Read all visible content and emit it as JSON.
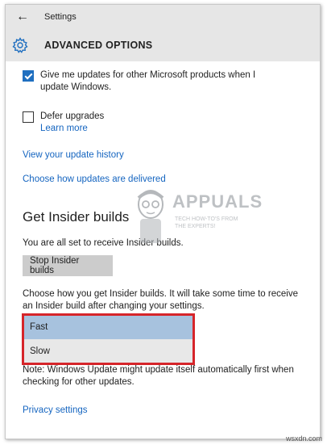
{
  "window": {
    "title": "Settings"
  },
  "header": {
    "page_title": "ADVANCED OPTIONS"
  },
  "options": {
    "microsoft_updates": {
      "label": "Give me updates for other Microsoft products when I update Windows.",
      "checked": true
    },
    "defer_upgrades": {
      "label": "Defer upgrades",
      "checked": false
    },
    "learn_more": "Learn more",
    "view_history": "View your update history",
    "choose_delivery": "Choose how updates are delivered"
  },
  "insider": {
    "heading": "Get Insider builds",
    "status": "You are all set to receive Insider builds.",
    "stop_button": "Stop Insider builds",
    "choose_text": "Choose how you get Insider builds. It will take some time to receive an Insider build after changing your settings.",
    "ring_options": [
      "Fast",
      "Slow"
    ],
    "selected_ring": "Fast",
    "note": "Note: Windows Update might update itself automatically first when checking for other updates."
  },
  "privacy_link": "Privacy settings",
  "watermark": {
    "brand": "APPUALS",
    "tagline": "TECH HOW-TO'S FROM THE EXPERTS!"
  },
  "site_credit": "wsxdn.com",
  "colors": {
    "accent": "#1f6fc0",
    "link": "#1565c0",
    "highlight": "#a7c2de",
    "annotation": "#d6252a"
  }
}
